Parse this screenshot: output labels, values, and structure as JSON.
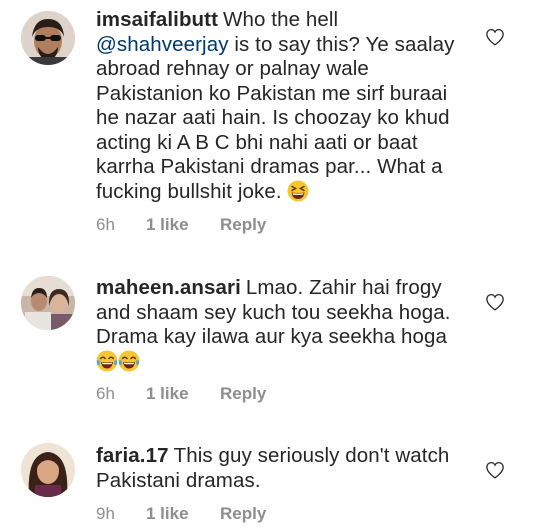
{
  "comments": [
    {
      "username": "imsaifalibutt",
      "text_before": "Who the hell",
      "mention": "@shahveerjay",
      "text_after": "is to say this? Ye saalay abroad rehnay or palnay wale Pakistanion ko Pakistan me sirf buraai he nazar aati hain. Is choozay ko khud acting ki A B C bhi nahi aati or baat karrha Pakistani dramas par... What a fucking bullshit joke.",
      "emoji": [
        "grinning-squinting-face"
      ],
      "time": "6h",
      "likes": "1 like",
      "reply_label": "Reply"
    },
    {
      "username": "maheen.ansari",
      "text": "Lmao. Zahir hai frogy and shaam sey kuch tou seekha hoga. Drama kay ilawa aur kya seekha hoga",
      "emoji": [
        "face-with-tears-of-joy",
        "face-with-tears-of-joy"
      ],
      "time": "6h",
      "likes": "1 like",
      "reply_label": "Reply"
    },
    {
      "username": "faria.17",
      "text": "This guy seriously don't watch Pakistani dramas.",
      "time": "9h",
      "likes": "1 like",
      "reply_label": "Reply"
    }
  ],
  "colors": {
    "text": "#262626",
    "meta": "#8e8e8e",
    "mention": "#00376b",
    "emoji_yellow": "#f7c531"
  },
  "icons": {
    "like": "heart-outline-icon"
  }
}
